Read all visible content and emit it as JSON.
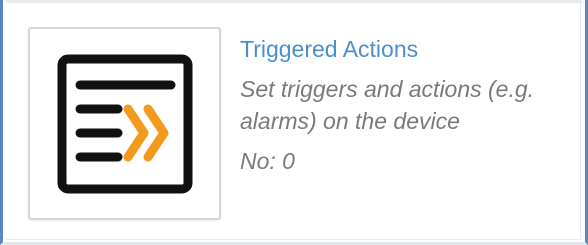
{
  "colors": {
    "frame_accent": "#5b86c5",
    "title": "#4a8fcf",
    "secondary_text": "#7a7a7a",
    "icon_dark": "#111111",
    "icon_accent": "#f39a1e"
  },
  "item": {
    "icon": "triggered-actions-icon",
    "title": "Triggered Actions",
    "description": "Set triggers and actions (e.g. alarms) on the device",
    "count": "No: 0"
  }
}
